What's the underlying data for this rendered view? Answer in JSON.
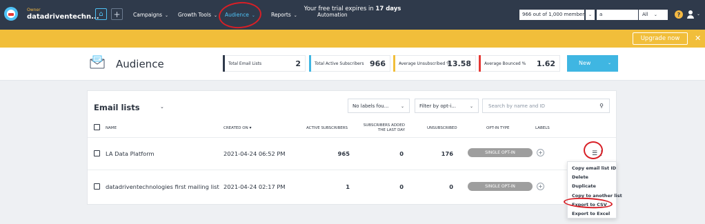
{
  "nav": {
    "owner_label": "Owner",
    "owner_name": "datadriventechn...",
    "items": [
      {
        "label": "Campaigns",
        "chevron": "⌄"
      },
      {
        "label": "Growth Tools",
        "chevron": "⌄"
      },
      {
        "label": "Audience",
        "chevron": "⌄",
        "active": true
      },
      {
        "label": "Reports",
        "chevron": "⌄"
      },
      {
        "label": "Automation"
      }
    ],
    "members_select": "966 out of 1,000 members",
    "search_value": "a",
    "scope_select": "All",
    "help_icon": "question-circle-icon",
    "user_icon": "user-icon"
  },
  "banner": {
    "text_prefix": "Your free trial expires in",
    "days": "17 days",
    "upgrade_label": "Upgrade now",
    "close_glyph": "✕"
  },
  "header": {
    "title": "Audience",
    "stats": [
      {
        "label": "Total Email Lists",
        "value": "2",
        "color": "#2f3a4b"
      },
      {
        "label": "Total Active Subscribers",
        "value": "966",
        "color": "#3fb6e2"
      },
      {
        "label": "Average Unsubscribed %",
        "value": "13.58",
        "color": "#f1be3a"
      },
      {
        "label": "Average Bounced %",
        "value": "1.62",
        "color": "#e53935"
      }
    ],
    "new_button": "New"
  },
  "email_lists": {
    "title": "Email lists",
    "label_filter": "No labels fou...",
    "optin_filter": "Filter by opt-i...",
    "search_placeholder": "Search by name and ID",
    "columns": {
      "name": "NAME",
      "created_on": "CREATED ON",
      "active_subscribers": "ACTIVE SUBSCRIBERS",
      "added_line1": "SUBSCRIBERS ADDED",
      "added_line2": "THE LAST DAY",
      "unsubscribed": "UNSUBSCRIBED",
      "optin_type": "OPT-IN TYPE",
      "labels": "LABELS"
    },
    "rows": [
      {
        "name": "LA Data Platform",
        "created_on": "2021-04-24 06:52 PM",
        "active": "965",
        "added": "0",
        "unsubscribed": "176",
        "optin": "SINGLE OPT-IN"
      },
      {
        "name": "datadriventechnologies first mailing list",
        "created_on": "2021-04-24 02:17 PM",
        "active": "1",
        "added": "0",
        "unsubscribed": "0",
        "optin": "SINGLE OPT-IN"
      }
    ],
    "row_menu": [
      "Copy email list ID",
      "Delete",
      "Duplicate",
      "Copy to another list",
      "Export to CSV",
      "Export to Excel"
    ]
  },
  "colors": {
    "nav_bg": "#2f3a4b",
    "accent": "#4fc3f7",
    "banner": "#f1be3a",
    "new_button": "#3fb6e2",
    "pill": "#9e9e9e",
    "annotation": "#d81f26"
  }
}
